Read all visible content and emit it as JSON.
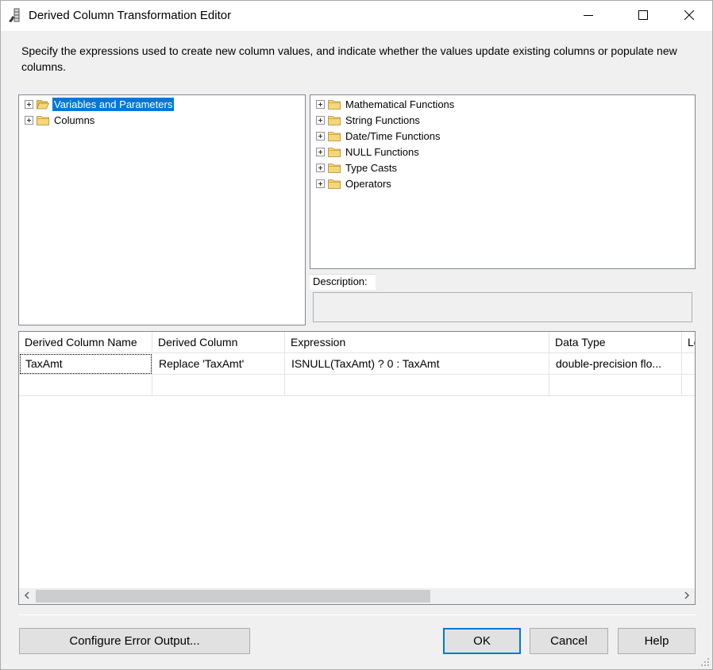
{
  "window": {
    "title": "Derived Column Transformation Editor"
  },
  "instructions": "Specify the expressions used to create new column values, and indicate whether the values update existing columns or populate new columns.",
  "left_tree": {
    "items": [
      {
        "label": "Variables and Parameters",
        "selected": true,
        "icon": "open-folder-icon"
      },
      {
        "label": "Columns",
        "selected": false,
        "icon": "folder-icon"
      }
    ]
  },
  "right_tree": {
    "items": [
      {
        "label": "Mathematical Functions"
      },
      {
        "label": "String Functions"
      },
      {
        "label": "Date/Time Functions"
      },
      {
        "label": "NULL Functions"
      },
      {
        "label": "Type Casts"
      },
      {
        "label": "Operators"
      }
    ]
  },
  "description": {
    "label": "Description:",
    "value": ""
  },
  "grid": {
    "columns": [
      "Derived Column Name",
      "Derived Column",
      "Expression",
      "Data Type",
      "Le"
    ],
    "rows": [
      [
        "TaxAmt",
        "Replace 'TaxAmt'",
        "ISNULL(TaxAmt) ? 0 : TaxAmt",
        "double-precision flo...",
        ""
      ],
      [
        "",
        "",
        "",
        "",
        ""
      ]
    ],
    "scroll_position": 0.0
  },
  "buttons": {
    "configure": "Configure Error Output...",
    "ok": "OK",
    "cancel": "Cancel",
    "help": "Help"
  },
  "colors": {
    "selection": "#0078d7",
    "folder": "#e8c15a",
    "background": "#f0f0f0"
  }
}
